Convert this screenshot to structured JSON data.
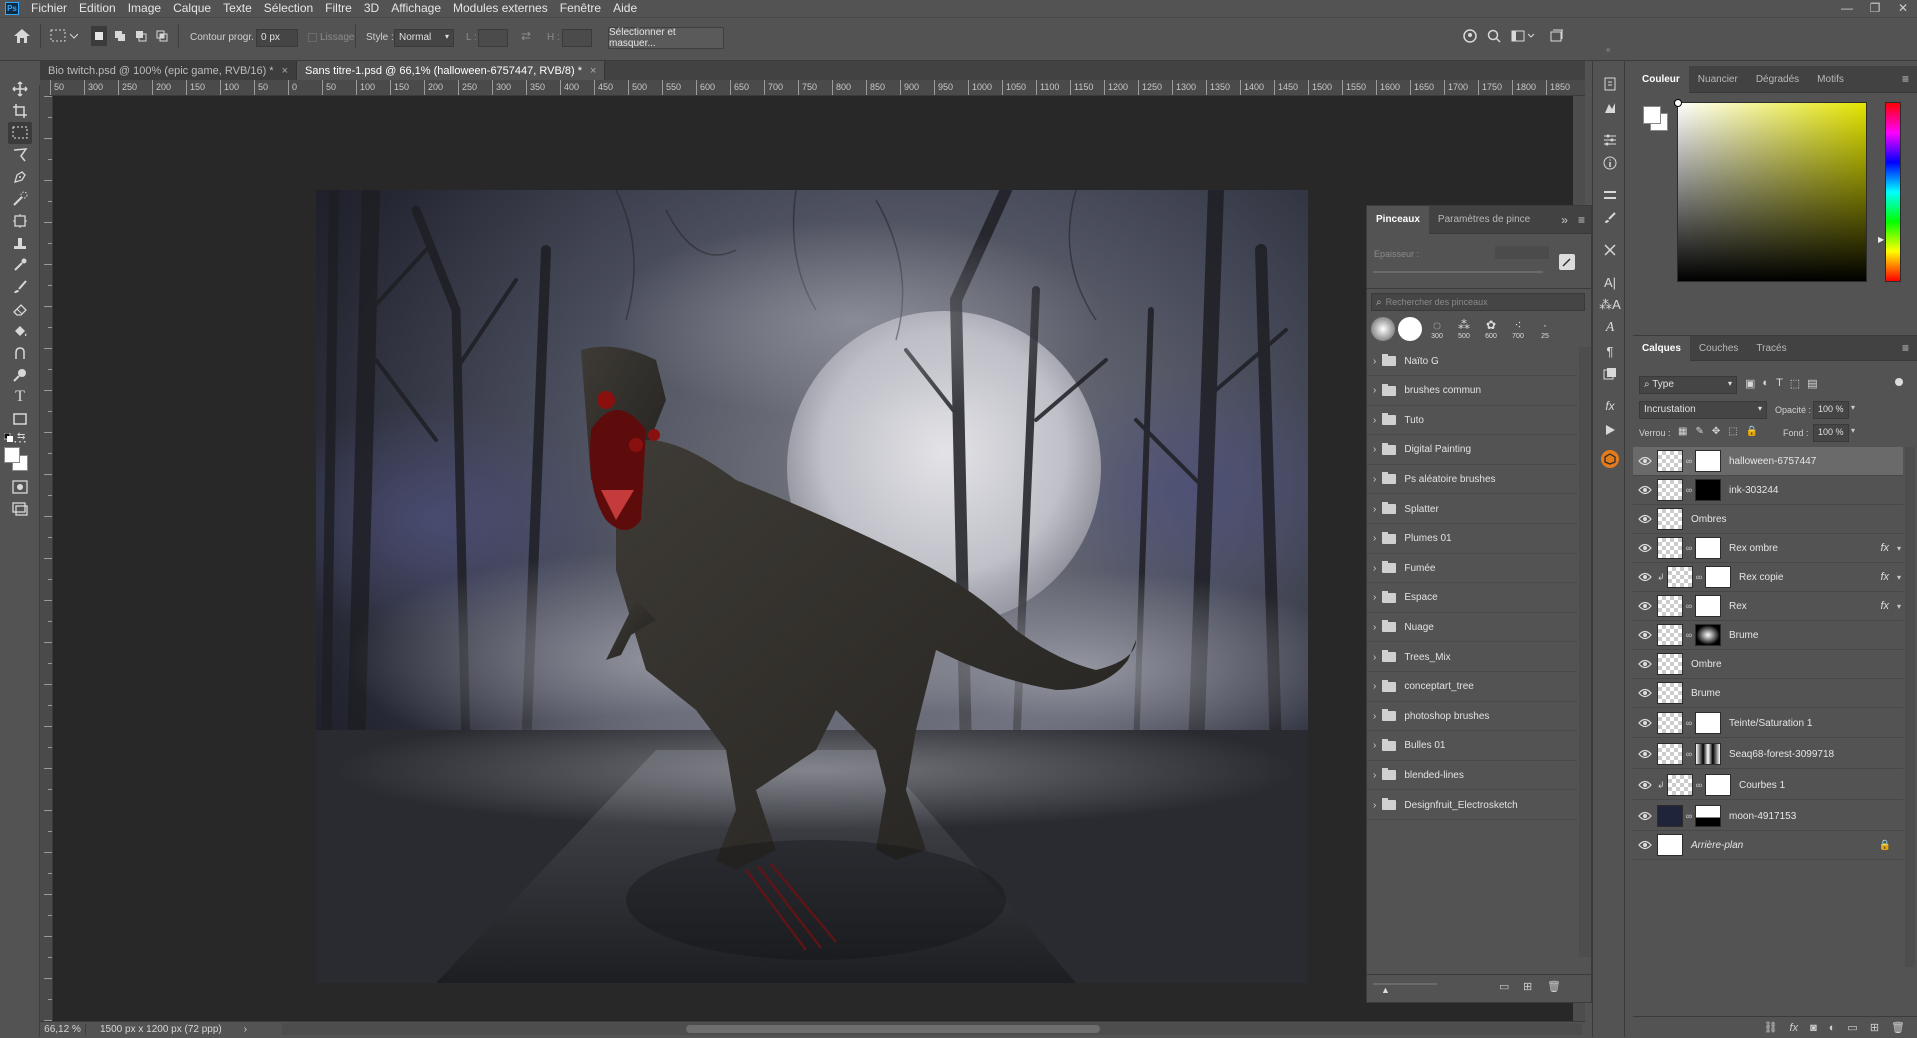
{
  "app": {
    "menu": [
      "Fichier",
      "Edition",
      "Image",
      "Calque",
      "Texte",
      "Sélection",
      "Filtre",
      "3D",
      "Affichage",
      "Modules externes",
      "Fenêtre",
      "Aide"
    ]
  },
  "options": {
    "contour_label": "Contour progr. :",
    "contour_value": "0 px",
    "lissage_label": "Lissage",
    "style_label": "Style :",
    "style_value": "Normal",
    "l_label": "L :",
    "h_label": "H :",
    "select_mask_button": "Sélectionner et masquer..."
  },
  "tabs": [
    {
      "label": "Bio twitch.psd @ 100% (epic game, RVB/16) *",
      "active": false
    },
    {
      "label": "Sans titre-1.psd @ 66,1% (halloween-6757447, RVB/8) *",
      "active": true
    }
  ],
  "ruler": {
    "labels": [
      "50",
      "300",
      "250",
      "200",
      "150",
      "100",
      "50",
      "0",
      "50",
      "100",
      "150",
      "200",
      "250",
      "300",
      "350",
      "400",
      "450",
      "500",
      "550",
      "600",
      "650",
      "700",
      "750",
      "800",
      "850",
      "900",
      "950",
      "1000",
      "1050",
      "1100",
      "1150",
      "1200",
      "1250",
      "1300",
      "1350",
      "1400",
      "1450",
      "1500",
      "1550",
      "1600",
      "1650",
      "1700",
      "1750",
      "1800",
      "1850"
    ]
  },
  "status": {
    "zoom": "66,12 %",
    "doc_size": "1500 px x 1200 px (72 ppp)"
  },
  "brushes_panel": {
    "tab_active": "Pinceaux",
    "tab_other": "Paramètres de pince",
    "thickness_label": "Epaisseur :",
    "search_placeholder": "Rechercher des pinceaux",
    "preset_sizes": [
      "300",
      "500",
      "600",
      "700",
      "25"
    ],
    "folders": [
      "Naïto G",
      "brushes commun",
      "Tuto",
      "Digital Painting",
      "Ps aléatoire brushes",
      "Splatter",
      "Plumes 01",
      "Fumée",
      "Espace",
      "Nuage",
      "Trees_Mix",
      "conceptart_tree",
      "photoshop brushes",
      "Bulles 01",
      "blended-lines",
      "Designfruit_Electrosketch"
    ]
  },
  "color_panel": {
    "tabs": [
      "Couleur",
      "Nuancier",
      "Dégradés",
      "Motifs"
    ],
    "active": "Couleur",
    "hue_color": "#e4e400"
  },
  "layers_panel": {
    "tabs": [
      "Calques",
      "Couches",
      "Tracés"
    ],
    "active": "Calques",
    "filter_value": "Type",
    "blend_mode": "Incrustation",
    "opacity_label": "Opacité :",
    "opacity_value": "100 %",
    "lock_label": "Verrou :",
    "fill_label": "Fond :",
    "fill_value": "100 %",
    "layers": [
      {
        "name": "halloween-6757447",
        "selected": true,
        "mask": "white",
        "fx": false,
        "clip": false,
        "italic": false
      },
      {
        "name": "ink-303244",
        "selected": false,
        "mask": "black",
        "fx": false,
        "clip": false,
        "italic": false
      },
      {
        "name": "Ombres",
        "selected": false,
        "mask": "none",
        "fx": false,
        "clip": false,
        "italic": false
      },
      {
        "name": "Rex ombre",
        "selected": false,
        "mask": "white",
        "fx": true,
        "clip": false,
        "italic": false
      },
      {
        "name": "Rex copie",
        "selected": false,
        "mask": "white",
        "fx": true,
        "clip": true,
        "italic": false
      },
      {
        "name": "Rex",
        "selected": false,
        "mask": "white",
        "fx": true,
        "clip": false,
        "italic": false
      },
      {
        "name": "Brume",
        "selected": false,
        "mask": "radial",
        "fx": false,
        "clip": false,
        "italic": false
      },
      {
        "name": "Ombre",
        "selected": false,
        "mask": "none",
        "fx": false,
        "clip": false,
        "italic": false
      },
      {
        "name": "Brume",
        "selected": false,
        "mask": "none",
        "fx": false,
        "clip": false,
        "italic": false
      },
      {
        "name": "Teinte/Saturation 1",
        "selected": false,
        "mask": "white",
        "fx": false,
        "clip": false,
        "italic": false
      },
      {
        "name": "Seaq68-forest-3099718",
        "selected": false,
        "mask": "trees",
        "fx": false,
        "clip": false,
        "italic": false
      },
      {
        "name": "Courbes 1",
        "selected": false,
        "mask": "white",
        "fx": false,
        "clip": true,
        "italic": false
      },
      {
        "name": "moon-4917153",
        "selected": false,
        "mask": "dark",
        "fx": false,
        "clip": false,
        "italic": false
      },
      {
        "name": "Arrière-plan",
        "selected": false,
        "mask": "none",
        "fx": false,
        "clip": false,
        "italic": true
      }
    ]
  }
}
